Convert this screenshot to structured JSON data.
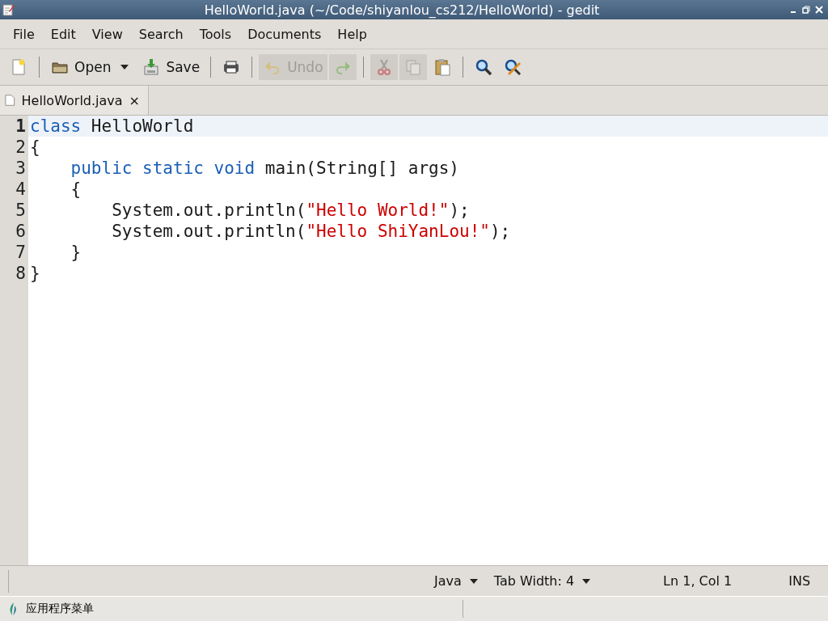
{
  "window": {
    "title": "HelloWorld.java (~/Code/shiyanlou_cs212/HelloWorld) - gedit"
  },
  "menu": [
    "File",
    "Edit",
    "View",
    "Search",
    "Tools",
    "Documents",
    "Help"
  ],
  "toolbar": [
    {
      "kind": "button",
      "disabled": false
    },
    {
      "kind": "separator"
    },
    {
      "kind": "button",
      "label": "Open",
      "disabled": false
    },
    {
      "kind": "dropdown",
      "disabled": false
    },
    {
      "kind": "button",
      "label": "Save",
      "disabled": false
    },
    {
      "kind": "separator"
    },
    {
      "kind": "button",
      "disabled": false
    },
    {
      "kind": "separator"
    },
    {
      "kind": "button",
      "label": "Undo",
      "disabled": true
    },
    {
      "kind": "button",
      "disabled": true
    },
    {
      "kind": "separator"
    },
    {
      "kind": "button",
      "disabled": true
    },
    {
      "kind": "button",
      "disabled": true
    },
    {
      "kind": "button",
      "disabled": false
    },
    {
      "kind": "separator"
    },
    {
      "kind": "button",
      "disabled": false
    },
    {
      "kind": "button",
      "disabled": false
    }
  ],
  "tabs": [
    {
      "label": "HelloWorld.java",
      "selected": true,
      "close": "×"
    }
  ],
  "editor": {
    "lines": [
      {
        "number": "1",
        "current": true,
        "tokens": [
          {
            "kind": "keyword",
            "text": "class"
          },
          {
            "kind": "plain",
            "text": " HelloWorld"
          }
        ]
      },
      {
        "number": "2",
        "current": false,
        "tokens": [
          {
            "kind": "plain",
            "text": "{"
          }
        ]
      },
      {
        "number": "3",
        "current": false,
        "tokens": [
          {
            "kind": "keyword",
            "text": "    public static void"
          },
          {
            "kind": "plain",
            "text": " main(String[] args)"
          }
        ]
      },
      {
        "number": "4",
        "current": false,
        "tokens": [
          {
            "kind": "plain",
            "text": "    {"
          }
        ]
      },
      {
        "number": "5",
        "current": false,
        "tokens": [
          {
            "kind": "plain",
            "text": "        System.out.println("
          },
          {
            "kind": "string",
            "text": "\"Hello World!\""
          },
          {
            "kind": "plain",
            "text": ");"
          }
        ]
      },
      {
        "number": "6",
        "current": false,
        "tokens": [
          {
            "kind": "plain",
            "text": "        System.out.println("
          },
          {
            "kind": "string",
            "text": "\"Hello ShiYanLou!\""
          },
          {
            "kind": "plain",
            "text": ");"
          }
        ]
      },
      {
        "number": "7",
        "current": false,
        "tokens": [
          {
            "kind": "plain",
            "text": "    }"
          }
        ]
      },
      {
        "number": "8",
        "current": false,
        "tokens": [
          {
            "kind": "plain",
            "text": "}"
          }
        ]
      }
    ]
  },
  "status_bar": {
    "language": "Java",
    "tab_width": "Tab Width: 4",
    "position": "Ln 1, Col 1",
    "mode": "INS"
  },
  "taskbar": {
    "menu": "应用程序菜单"
  }
}
